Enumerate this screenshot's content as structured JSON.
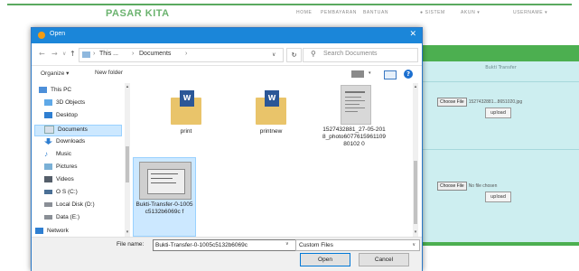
{
  "website": {
    "brand": "PASAR KITA",
    "nav": [
      "HOME",
      "PEMBAYARAN",
      "BANTUAN",
      "● SISTEM",
      "AKUN ▾",
      "USERNAME ▾"
    ],
    "panel_header": "Bukti Transfer",
    "rows": [
      {
        "choose_label": "Choose File",
        "file_text": "1527432881...8651020.jpg",
        "upload_label": "upload"
      },
      {
        "choose_label": "Choose File",
        "file_text": "No file chosen",
        "upload_label": "upload"
      }
    ]
  },
  "dialog": {
    "title": "Open",
    "close": "✕",
    "breadcrumb": [
      "This ...",
      "Documents"
    ],
    "search_placeholder": "Search Documents",
    "toolbar": {
      "organize": "Organize ▾",
      "new_folder": "New folder"
    },
    "sidebar": [
      {
        "label": "This PC",
        "icon": "pc-icon"
      },
      {
        "label": "3D Objects",
        "icon": "3d-objects-icon"
      },
      {
        "label": "Desktop",
        "icon": "desktop-icon"
      },
      {
        "label": "Documents",
        "icon": "documents-icon",
        "selected": true
      },
      {
        "label": "Downloads",
        "icon": "downloads-icon"
      },
      {
        "label": "Music",
        "icon": "music-icon"
      },
      {
        "label": "Pictures",
        "icon": "pictures-icon"
      },
      {
        "label": "Videos",
        "icon": "videos-icon"
      },
      {
        "label": "O S (C:)",
        "icon": "drive-icon"
      },
      {
        "label": "Local Disk (D:)",
        "icon": "drive-icon"
      },
      {
        "label": "Data (E:)",
        "icon": "drive-icon"
      },
      {
        "label": "Network",
        "icon": "network-icon"
      }
    ],
    "files": [
      {
        "name": "print",
        "kind": "folder"
      },
      {
        "name": "printnew",
        "kind": "folder"
      },
      {
        "name": "1527432881_27-05-2018_photo607761596110980102 0",
        "kind": "image"
      },
      {
        "name": "Bukti-Transfer-0-1005c5132b6069c f",
        "kind": "image",
        "selected": true
      }
    ],
    "file_name_label": "File name:",
    "file_name_value": "Bukti-Transfer-0-1005c5132b6069c",
    "filter": "Custom Files",
    "open_label": "Open",
    "cancel_label": "Cancel"
  },
  "colors": {
    "titlebar": "#1b86d9",
    "brand": "#6bb36f",
    "green": "#4caf50",
    "panel": "#cdeef0"
  }
}
